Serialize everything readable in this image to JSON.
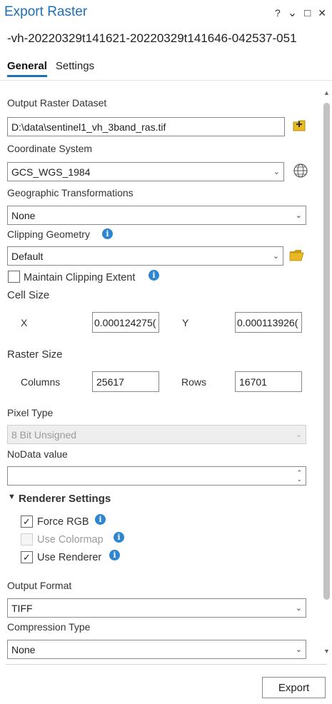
{
  "window": {
    "title": "Export Raster",
    "help": "?",
    "menu": "⌄",
    "restore": "□",
    "close": "✕"
  },
  "subtitle": "-vh-20220329t141621-20220329t141646-042537-051",
  "tabs": [
    "General",
    "Settings"
  ],
  "output_raster": {
    "label": "Output Raster Dataset",
    "value": "D:\\data\\sentinel1_vh_3band_ras.tif"
  },
  "coordinate_system": {
    "label": "Coordinate System",
    "value": "GCS_WGS_1984"
  },
  "geo_transform": {
    "label": "Geographic Transformations",
    "value": "None"
  },
  "clipping": {
    "label": "Clipping Geometry",
    "value": "Default",
    "maintain_label": "Maintain Clipping Extent"
  },
  "cell_size": {
    "label": "Cell Size",
    "x_label": "X",
    "x_value": "0.000124275(",
    "y_label": "Y",
    "y_value": "0.000113926("
  },
  "raster_size": {
    "label": "Raster Size",
    "columns_label": "Columns",
    "columns_value": "25617",
    "rows_label": "Rows",
    "rows_value": "16701"
  },
  "pixel_type": {
    "label": "Pixel Type",
    "value": "8 Bit Unsigned"
  },
  "nodata": {
    "label": "NoData value",
    "value": ""
  },
  "renderer": {
    "header": "Renderer Settings",
    "force_rgb": "Force RGB",
    "use_colormap": "Use Colormap",
    "use_renderer": "Use Renderer"
  },
  "output_format": {
    "label": "Output Format",
    "value": "TIFF"
  },
  "compression": {
    "label": "Compression Type",
    "value": "None"
  },
  "export_button": "Export",
  "colors": {
    "accent": "#1e6fb7",
    "info": "#2f86d0",
    "folder": "#e8b923"
  }
}
